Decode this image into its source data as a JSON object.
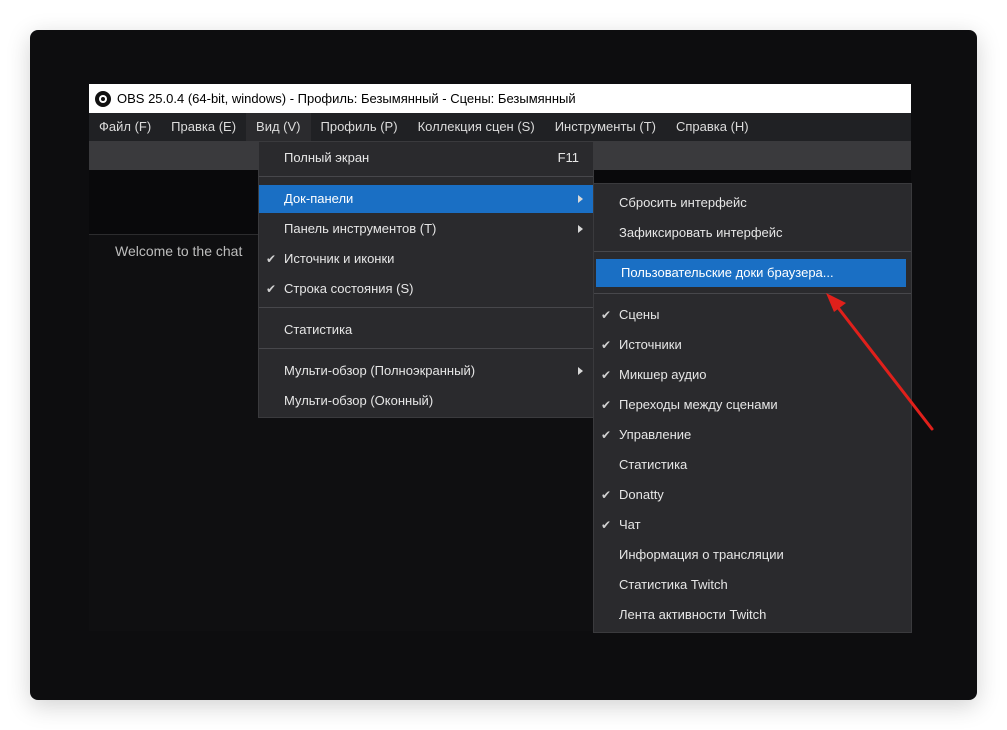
{
  "window": {
    "title": "OBS 25.0.4 (64-bit, windows) - Профиль: Безымянный - Сцены: Безымянный"
  },
  "menubar": {
    "items": [
      {
        "label": "Файл (F)"
      },
      {
        "label": "Правка (E)"
      },
      {
        "label": "Вид (V)"
      },
      {
        "label": "Профиль (P)"
      },
      {
        "label": "Коллекция сцен (S)"
      },
      {
        "label": "Инструменты (T)"
      },
      {
        "label": "Справка (H)"
      }
    ]
  },
  "chat": {
    "welcome": "Welcome to the chat"
  },
  "view_menu": {
    "items": [
      {
        "label": "Полный экран",
        "shortcut": "F11",
        "checked": false
      },
      {
        "label": "Док-панели",
        "checked": false,
        "submenu": true,
        "highlighted": true
      },
      {
        "label": "Панель инструментов (T)",
        "checked": false,
        "submenu": true
      },
      {
        "label": "Источник и иконки",
        "checked": true
      },
      {
        "label": "Строка состояния (S)",
        "checked": true
      },
      {
        "label": "Статистика",
        "checked": false
      },
      {
        "label": "Мульти-обзор (Полноэкранный)",
        "checked": false,
        "submenu": true
      },
      {
        "label": "Мульти-обзор (Оконный)",
        "checked": false
      }
    ]
  },
  "docks_menu": {
    "items": [
      {
        "label": "Сбросить интерфейс",
        "checked": false
      },
      {
        "label": "Зафиксировать интерфейс",
        "checked": false
      },
      {
        "label": "Пользовательские доки браузера...",
        "checked": false,
        "highlighted": true
      },
      {
        "label": "Сцены",
        "checked": true
      },
      {
        "label": "Источники",
        "checked": true
      },
      {
        "label": "Микшер аудио",
        "checked": true
      },
      {
        "label": "Переходы между сценами",
        "checked": true
      },
      {
        "label": "Управление",
        "checked": true
      },
      {
        "label": "Статистика",
        "checked": false
      },
      {
        "label": "Donatty",
        "checked": true
      },
      {
        "label": "Чат",
        "checked": true
      },
      {
        "label": "Информация о трансляции",
        "checked": false
      },
      {
        "label": "Статистика Twitch",
        "checked": false
      },
      {
        "label": "Лента активности Twitch",
        "checked": false
      }
    ]
  },
  "glyphs": {
    "check": "✔"
  },
  "colors": {
    "highlight": "#1a6fc4",
    "annotation_arrow": "#e0201b",
    "menu_bg": "#2a2a2d"
  }
}
